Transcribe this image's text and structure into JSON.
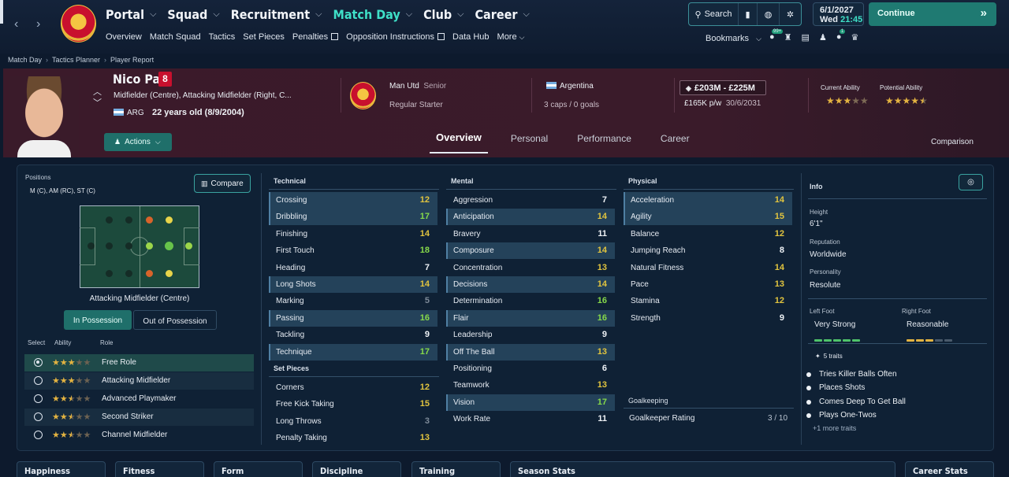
{
  "nav": {
    "main": [
      "Portal",
      "Squad",
      "Recruitment",
      "Match Day",
      "Club",
      "Career"
    ],
    "active": "Match Day",
    "sub": [
      "Overview",
      "Match Squad",
      "Tactics",
      "Set Pieces",
      "Penalties",
      "Opposition Instructions",
      "Data Hub",
      "More"
    ],
    "search_label": "Search",
    "date": "6/1/2027",
    "day_time": "Wed",
    "time": "21:45",
    "continue_label": "Continue",
    "bookmarks_label": "Bookmarks",
    "badge_a": "99+",
    "badge_b": "1"
  },
  "breadcrumb": [
    "Match Day",
    "Tactics Planner",
    "Player Report"
  ],
  "player": {
    "name": "Nico Paz",
    "number": "8",
    "positions": "Midfielder (Centre), Attacking Midfielder (Right, C...",
    "nationality_code": "ARG",
    "age": "22 years old (8/9/2004)",
    "actions_label": "Actions",
    "club": "Man Utd",
    "squad": "Senior",
    "squad_status": "Regular Starter",
    "country": "Argentina",
    "caps": "3 caps / 0 goals",
    "value": "£203M - £225M",
    "wage": "£165K p/w",
    "contract": "30/6/2031",
    "current_ability_label": "Current Ability",
    "potential_ability_label": "Potential Ability",
    "current_ability_stars": 3,
    "potential_ability_stars": 4.5
  },
  "profile_tabs": [
    "Overview",
    "Personal",
    "Performance",
    "Career"
  ],
  "active_profile_tab": "Overview",
  "comparison_label": "Comparison",
  "positions_panel": {
    "title": "Positions",
    "summary": "M (C), AM (RC), ST (C)",
    "compare_label": "Compare",
    "selected_position": "Attacking Midfielder (Centre)",
    "in_possession": "In Possession",
    "out_possession": "Out of Possession",
    "headers": {
      "select": "Select",
      "ability": "Ability",
      "role": "Role"
    },
    "roles": [
      {
        "name": "Free Role",
        "stars": 3,
        "selected": true
      },
      {
        "name": "Attacking Midfielder",
        "stars": 3,
        "selected": false
      },
      {
        "name": "Advanced Playmaker",
        "stars": 2.5,
        "selected": false
      },
      {
        "name": "Second Striker",
        "stars": 2.5,
        "selected": false
      },
      {
        "name": "Channel Midfielder",
        "stars": 2.5,
        "selected": false
      }
    ]
  },
  "attributes": {
    "technical_title": "Technical",
    "technical": [
      {
        "name": "Crossing",
        "value": "12",
        "hl": true
      },
      {
        "name": "Dribbling",
        "value": "17",
        "hl": true
      },
      {
        "name": "Finishing",
        "value": "14",
        "hl": false
      },
      {
        "name": "First Touch",
        "value": "18",
        "hl": false
      },
      {
        "name": "Heading",
        "value": "7",
        "hl": false
      },
      {
        "name": "Long Shots",
        "value": "14",
        "hl": true
      },
      {
        "name": "Marking",
        "value": "5",
        "hl": false
      },
      {
        "name": "Passing",
        "value": "16",
        "hl": true
      },
      {
        "name": "Tackling",
        "value": "9",
        "hl": false
      },
      {
        "name": "Technique",
        "value": "17",
        "hl": true
      }
    ],
    "setpieces_title": "Set Pieces",
    "setpieces": [
      {
        "name": "Corners",
        "value": "12"
      },
      {
        "name": "Free Kick Taking",
        "value": "15"
      },
      {
        "name": "Long Throws",
        "value": "3"
      },
      {
        "name": "Penalty Taking",
        "value": "13"
      }
    ],
    "mental_title": "Mental",
    "mental": [
      {
        "name": "Aggression",
        "value": "7",
        "hl": false
      },
      {
        "name": "Anticipation",
        "value": "14",
        "hl": true
      },
      {
        "name": "Bravery",
        "value": "11",
        "hl": false
      },
      {
        "name": "Composure",
        "value": "14",
        "hl": true
      },
      {
        "name": "Concentration",
        "value": "13",
        "hl": false
      },
      {
        "name": "Decisions",
        "value": "14",
        "hl": true
      },
      {
        "name": "Determination",
        "value": "16",
        "hl": false
      },
      {
        "name": "Flair",
        "value": "16",
        "hl": true
      },
      {
        "name": "Leadership",
        "value": "9",
        "hl": false
      },
      {
        "name": "Off The Ball",
        "value": "13",
        "hl": true
      },
      {
        "name": "Positioning",
        "value": "6",
        "hl": false
      },
      {
        "name": "Teamwork",
        "value": "13",
        "hl": false
      },
      {
        "name": "Vision",
        "value": "17",
        "hl": true
      },
      {
        "name": "Work Rate",
        "value": "11",
        "hl": false
      }
    ],
    "physical_title": "Physical",
    "physical": [
      {
        "name": "Acceleration",
        "value": "14",
        "hl": true
      },
      {
        "name": "Agility",
        "value": "15",
        "hl": true
      },
      {
        "name": "Balance",
        "value": "12",
        "hl": false
      },
      {
        "name": "Jumping Reach",
        "value": "8",
        "hl": false
      },
      {
        "name": "Natural Fitness",
        "value": "14",
        "hl": false
      },
      {
        "name": "Pace",
        "value": "13",
        "hl": false
      },
      {
        "name": "Stamina",
        "value": "12",
        "hl": false
      },
      {
        "name": "Strength",
        "value": "9",
        "hl": false
      }
    ],
    "goalkeeping_title": "Goalkeeping",
    "goalkeeper_rating_label": "Goalkeeper Rating",
    "goalkeeper_rating": "3 / 10"
  },
  "info": {
    "title": "Info",
    "height_label": "Height",
    "height": "6'1\"",
    "reputation_label": "Reputation",
    "reputation": "Worldwide",
    "personality_label": "Personality",
    "personality": "Resolute",
    "left_foot_label": "Left Foot",
    "left_foot": "Very Strong",
    "right_foot_label": "Right Foot",
    "right_foot": "Reasonable",
    "left_foot_level": 5,
    "right_foot_level": 3,
    "traits_label": "5 traits",
    "traits": [
      "Tries Killer Balls Often",
      "Places Shots",
      "Comes Deep To Get Ball",
      "Plays One-Twos"
    ],
    "more_traits": "+1 more traits"
  },
  "bottom_tabs": [
    "Happiness",
    "Fitness",
    "Form",
    "Discipline",
    "Training",
    "Season Stats",
    "Career Stats"
  ]
}
